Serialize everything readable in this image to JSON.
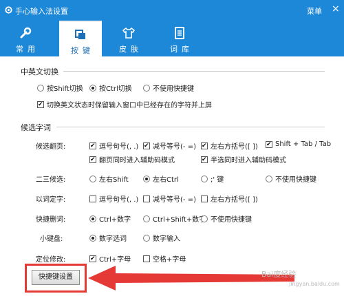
{
  "window": {
    "title": "手心输入法设置",
    "menu_label": "菜单",
    "close_label": "×"
  },
  "tabs": [
    {
      "label": "常用",
      "icon": "wrench-icon"
    },
    {
      "label": "按键",
      "icon": "keys-icon"
    },
    {
      "label": "皮肤",
      "icon": "shirt-icon"
    },
    {
      "label": "词库",
      "icon": "document-icon"
    }
  ],
  "colors": {
    "accent": "#1e88d8",
    "highlight": "#e53935"
  },
  "cn_en_switch": {
    "title": "中英文切换",
    "options": [
      {
        "label": "按Shift切换",
        "selected": false
      },
      {
        "label": "按Ctrl切换",
        "selected": true
      },
      {
        "label": "不使用快捷键",
        "selected": false
      }
    ],
    "keep_text_checkbox": {
      "label": "切换英文状态时保留输入窗口中已经存在的字符并上屏",
      "checked": true
    }
  },
  "candidates": {
    "title": "候选字词",
    "page_turn": {
      "label": "候选翻页:",
      "items": [
        {
          "label": "逗号句号(, .)",
          "checked": true
        },
        {
          "label": "减号等号(- =)",
          "checked": true
        },
        {
          "label": "左右方括号([ ])",
          "checked": true
        },
        {
          "label": "Shift + Tab / Tab",
          "checked": true
        }
      ],
      "items2": [
        {
          "label": "翻页同时进入辅助码模式",
          "checked": true
        },
        {
          "label": "半选同时进入辅助码模式",
          "checked": true
        }
      ]
    },
    "second_third": {
      "label": "二三候选:",
      "options": [
        {
          "label": "左右Shift",
          "selected": false
        },
        {
          "label": "左右Ctrl",
          "selected": true
        },
        {
          "label": ";' 键",
          "selected": false
        },
        {
          "label": "不使用快捷键",
          "selected": false
        }
      ]
    },
    "word_by_word": {
      "label": "以词定字:",
      "items": [
        {
          "label": "逗号句号(, .)",
          "checked": false
        },
        {
          "label": "减号等号(- =)",
          "checked": false
        },
        {
          "label": "左右方括号([ ])",
          "checked": false
        }
      ]
    },
    "quick_delete": {
      "label": "快捷删词:",
      "options": [
        {
          "label": "Ctrl+数字",
          "selected": true
        },
        {
          "label": "Ctrl+Shift+数字",
          "selected": false
        },
        {
          "label": "不使用快捷键",
          "selected": false
        }
      ]
    },
    "keypad": {
      "label": "小键盘:",
      "options": [
        {
          "label": "数字选词",
          "selected": true
        },
        {
          "label": "数字输入",
          "selected": false
        }
      ]
    },
    "locate": {
      "label": "定位修改:",
      "items": [
        {
          "label": "Ctrl+字母",
          "checked": true
        },
        {
          "label": "空格+字母",
          "checked": false
        }
      ]
    }
  },
  "shortcut_button_label": "快捷键设置",
  "watermark": {
    "text": "Bai度经验",
    "sub": "jingyan.baidu.com"
  }
}
